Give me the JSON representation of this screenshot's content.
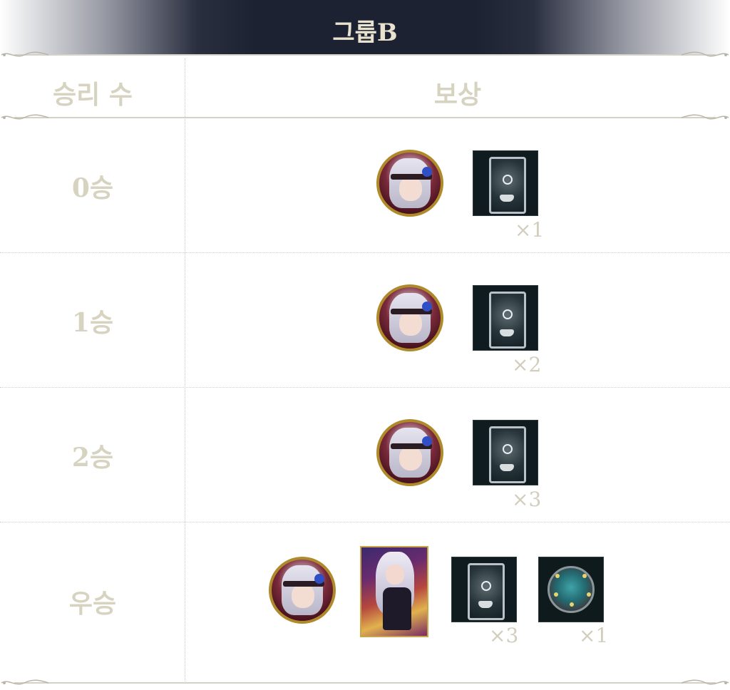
{
  "title": "그룹B",
  "header": {
    "wins_label": "승리 수",
    "reward_label": "보상"
  },
  "rows": [
    {
      "wins": "0승",
      "box_qty": "×1"
    },
    {
      "wins": "1승",
      "box_qty": "×2"
    },
    {
      "wins": "2승",
      "box_qty": "×3"
    },
    {
      "wins": "우승",
      "box_qty": "×3",
      "gem_qty": "×1"
    }
  ],
  "colors": {
    "title_bg": "#1d2232",
    "title_text": "#e8e2cf",
    "label_text": "#d7d3c1",
    "coin_border": "#b08a2a"
  }
}
